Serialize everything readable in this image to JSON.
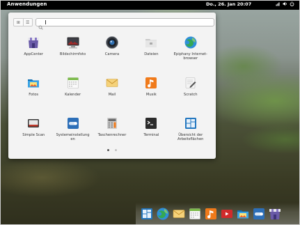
{
  "panel": {
    "menu_label": "Anwendungen",
    "clock": "Do., 26. Jan    20:07"
  },
  "launcher": {
    "view_grid_glyph": "⊞",
    "view_list_glyph": "☰",
    "search_placeholder": "",
    "search_value": "",
    "apps": [
      {
        "label": "AppCenter",
        "icon": "appcenter-icon"
      },
      {
        "label": "Bildschirmfoto",
        "icon": "screenshot-icon"
      },
      {
        "label": "Camera",
        "icon": "camera-icon"
      },
      {
        "label": "Dateien",
        "icon": "files-icon"
      },
      {
        "label": "Epiphany Internet-\nbrowser",
        "icon": "epiphany-browser-icon"
      },
      {
        "label": "Fotos",
        "icon": "photos-icon"
      },
      {
        "label": "Kalender",
        "icon": "calendar-icon"
      },
      {
        "label": "Mail",
        "icon": "mail-icon"
      },
      {
        "label": "Musik",
        "icon": "music-icon"
      },
      {
        "label": "Scratch",
        "icon": "scratch-editor-icon"
      },
      {
        "label": "Simple Scan",
        "icon": "scanner-icon"
      },
      {
        "label": "Systemeinstellung\nen",
        "icon": "system-settings-icon"
      },
      {
        "label": "Taschenrechner",
        "icon": "calculator-icon"
      },
      {
        "label": "Terminal",
        "icon": "terminal-icon"
      },
      {
        "label": "Übersicht der\nArbeitsflächen",
        "icon": "workspaces-overview-icon"
      }
    ],
    "pages": 2,
    "current_page": 1
  },
  "dock": [
    "workspaces-overview-icon",
    "epiphany-browser-icon",
    "mail-icon",
    "calendar-icon",
    "music-icon",
    "videos-icon",
    "photos-icon",
    "system-settings-icon",
    "appcenter-icon"
  ],
  "colors": {
    "panel": "#000000",
    "launcher_bg": "#f3f3f3",
    "page_dot_active": "#555555",
    "page_dot_inactive": "#c2c2c2"
  }
}
